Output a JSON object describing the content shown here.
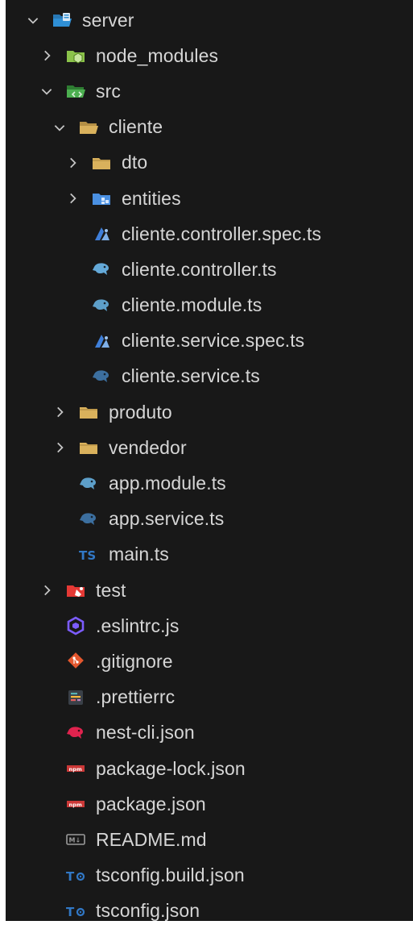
{
  "explorer": {
    "items": [
      {
        "label": "server",
        "depth": 0,
        "chevron": "open",
        "icon": "folder-server-open-icon",
        "color": "#2f8fd5"
      },
      {
        "label": "node_modules",
        "depth": 1,
        "chevron": "closed",
        "icon": "folder-node-icon",
        "color": "#8bc34a"
      },
      {
        "label": "src",
        "depth": 1,
        "chevron": "open",
        "icon": "folder-src-open-icon",
        "color": "#4caf50"
      },
      {
        "label": "cliente",
        "depth": 2,
        "chevron": "open",
        "icon": "folder-open-icon",
        "color": "#d9b15c"
      },
      {
        "label": "dto",
        "depth": 3,
        "chevron": "closed",
        "icon": "folder-icon",
        "color": "#d9b15c"
      },
      {
        "label": "entities",
        "depth": 3,
        "chevron": "closed",
        "icon": "folder-entities-icon",
        "color": "#4a90e2"
      },
      {
        "label": "cliente.controller.spec.ts",
        "depth": 3,
        "chevron": "none",
        "icon": "nest-spec-icon",
        "color": "#3f7fd9"
      },
      {
        "label": "cliente.controller.ts",
        "depth": 3,
        "chevron": "none",
        "icon": "nest-controller-icon",
        "color": "#64a9d8"
      },
      {
        "label": "cliente.module.ts",
        "depth": 3,
        "chevron": "none",
        "icon": "nest-module-icon",
        "color": "#5d9fc9"
      },
      {
        "label": "cliente.service.spec.ts",
        "depth": 3,
        "chevron": "none",
        "icon": "nest-spec-icon",
        "color": "#3f7fd9"
      },
      {
        "label": "cliente.service.ts",
        "depth": 3,
        "chevron": "none",
        "icon": "nest-service-icon",
        "color": "#3c6f9f"
      },
      {
        "label": "produto",
        "depth": 2,
        "chevron": "closed",
        "icon": "folder-icon",
        "color": "#d9b15c"
      },
      {
        "label": "vendedor",
        "depth": 2,
        "chevron": "closed",
        "icon": "folder-icon",
        "color": "#d9b15c"
      },
      {
        "label": "app.module.ts",
        "depth": 2,
        "chevron": "none",
        "icon": "nest-module-icon",
        "color": "#5d9fc9"
      },
      {
        "label": "app.service.ts",
        "depth": 2,
        "chevron": "none",
        "icon": "nest-service-icon",
        "color": "#3c6f9f"
      },
      {
        "label": "main.ts",
        "depth": 2,
        "chevron": "none",
        "icon": "typescript-icon",
        "color": "#3178c6"
      },
      {
        "label": "test",
        "depth": 1,
        "chevron": "closed",
        "icon": "folder-test-icon",
        "color": "#e53935"
      },
      {
        "label": ".eslintrc.js",
        "depth": 1,
        "chevron": "none",
        "icon": "eslint-icon",
        "color": "#7c5cff"
      },
      {
        "label": ".gitignore",
        "depth": 1,
        "chevron": "none",
        "icon": "git-icon",
        "color": "#e4572e"
      },
      {
        "label": ".prettierrc",
        "depth": 1,
        "chevron": "none",
        "icon": "prettier-icon",
        "color": "#56606b"
      },
      {
        "label": "nest-cli.json",
        "depth": 1,
        "chevron": "none",
        "icon": "nest-icon",
        "color": "#e0234e"
      },
      {
        "label": "package-lock.json",
        "depth": 1,
        "chevron": "none",
        "icon": "npm-icon",
        "color": "#cb3837"
      },
      {
        "label": "package.json",
        "depth": 1,
        "chevron": "none",
        "icon": "npm-icon",
        "color": "#cb3837"
      },
      {
        "label": "README.md",
        "depth": 1,
        "chevron": "none",
        "icon": "markdown-icon",
        "color": "#9a9a9a"
      },
      {
        "label": "tsconfig.build.json",
        "depth": 1,
        "chevron": "none",
        "icon": "tsconfig-icon",
        "color": "#3178c6"
      },
      {
        "label": "tsconfig.json",
        "depth": 1,
        "chevron": "none",
        "icon": "tsconfig-icon",
        "color": "#3178c6"
      }
    ]
  }
}
